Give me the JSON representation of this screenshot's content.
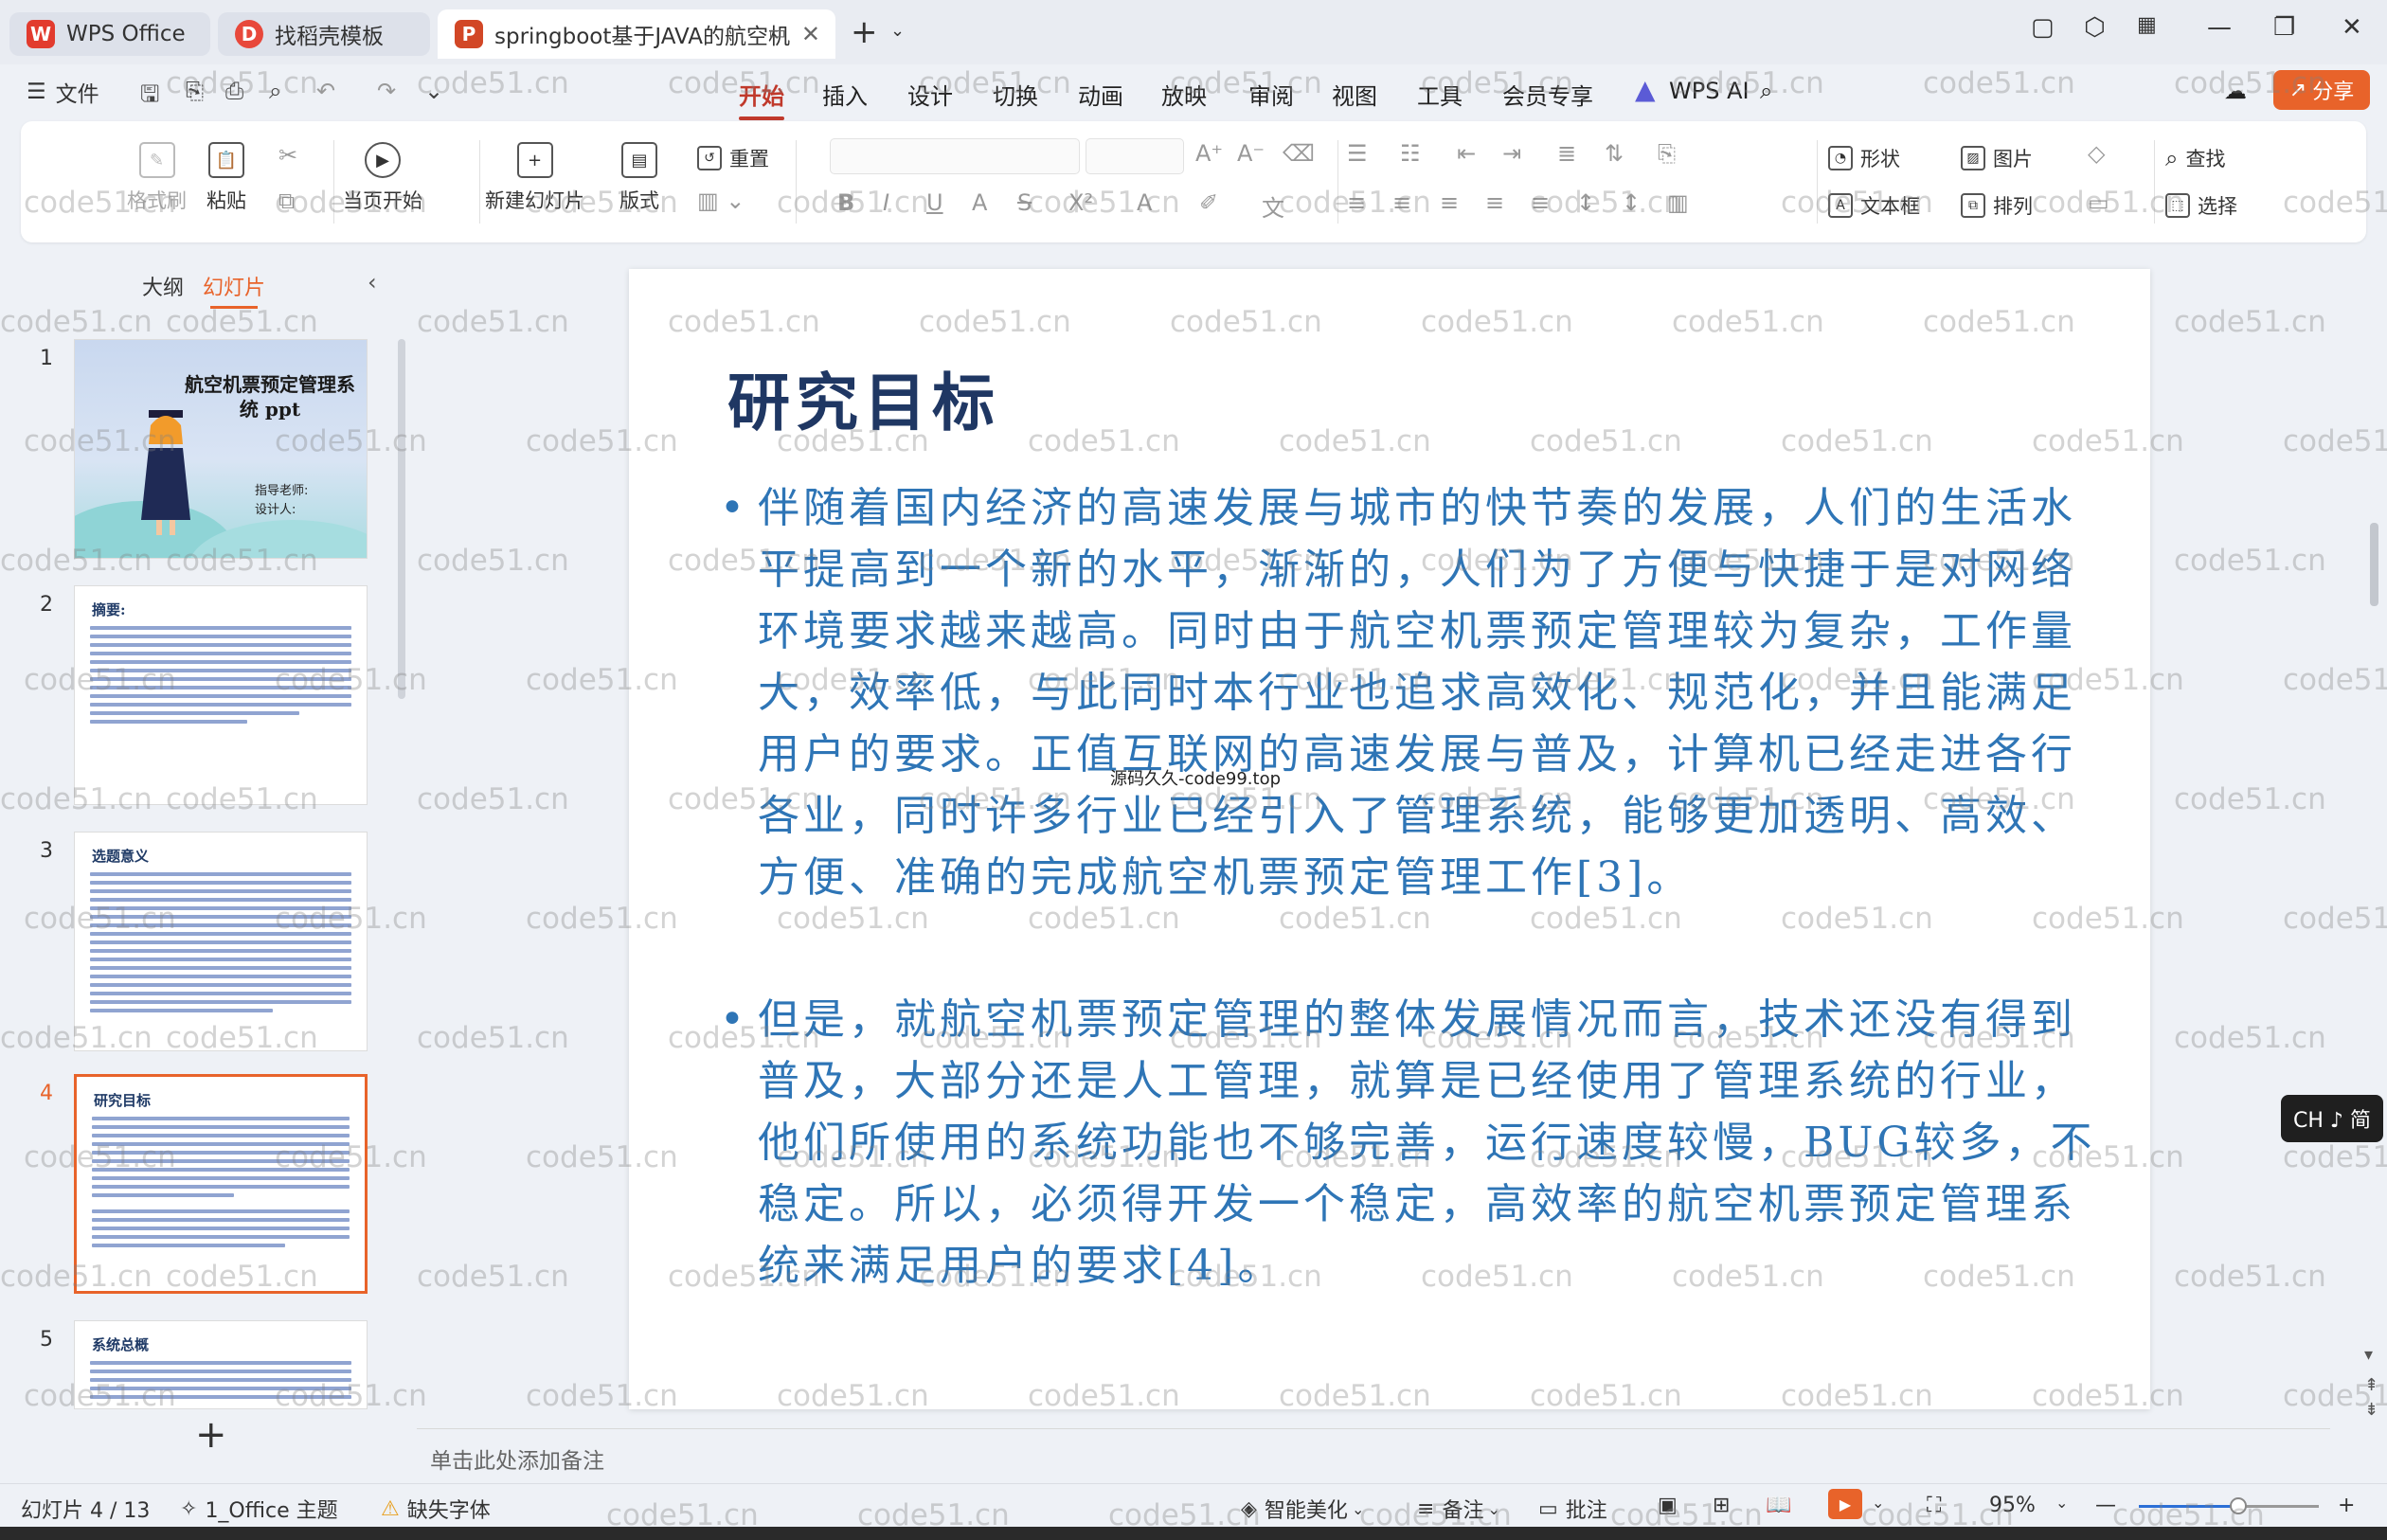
{
  "window": {
    "tabs": [
      {
        "label": "WPS Office",
        "logo": "W",
        "color": "#e23b2e"
      },
      {
        "label": "找稻壳模板",
        "logo": "D",
        "color": "#e8483b"
      },
      {
        "label": "springboot基于JAVA的航空机",
        "logo": "P",
        "color": "#d24726"
      }
    ]
  },
  "menu": {
    "file_label": "文件",
    "tabs": [
      "开始",
      "插入",
      "设计",
      "切换",
      "动画",
      "放映",
      "审阅",
      "视图",
      "工具",
      "会员专享",
      "WPS AI"
    ],
    "active_tab": "开始",
    "share_label": "分享"
  },
  "ribbon": {
    "format_painter": "格式刷",
    "paste": "粘贴",
    "play_current": "当页开始",
    "new_slide": "新建幻灯片",
    "layout": "版式",
    "reset": "重置",
    "shape": "形状",
    "picture": "图片",
    "find": "查找",
    "textbox": "文本框",
    "arrange": "排列",
    "select": "选择"
  },
  "panel": {
    "tab_outline": "大纲",
    "tab_slides": "幻灯片",
    "active_slide": 4,
    "slides": [
      {
        "num": "1",
        "title": "航空机票预定管理系统 ppt",
        "advisor": "指导老师:",
        "designer": "设计人:"
      },
      {
        "num": "2",
        "title": "摘要:"
      },
      {
        "num": "3",
        "title": "选题意义"
      },
      {
        "num": "4",
        "title": "研究目标"
      },
      {
        "num": "5",
        "title": "系统总概"
      }
    ]
  },
  "slide": {
    "title": "研究目标",
    "bullets": [
      "伴随着国内经济的高速发展与城市的快节奏的发展，人们的生活水平提高到一个新的水平，渐渐的，人们为了方便与快捷于是对网络环境要求越来越高。同时由于航空机票预定管理较为复杂，工作量大，效率低，与此同时本行业也追求高效化、规范化，并且能满足用户的要求。正值互联网的高速发展与普及，计算机已经走进各行各业，同时许多行业已经引入了管理系统，能够更加透明、高效、方便、准确的完成航空机票预定管理工作[3]。",
      "但是，就航空机票预定管理的整体发展情况而言，技术还没有得到普及，大部分还是人工管理，就算是已经使用了管理系统的行业，他们所使用的系统功能也不够完善，运行速度较慢，BUG较多，不稳定。所以，必须得开发一个稳定，高效率的航空机票预定管理系统来满足用户的要求[4]。"
    ],
    "overlay_text": "源码久久-code99.top"
  },
  "notes_placeholder": "单击此处添加备注",
  "ime": "CH ♪ 简",
  "status": {
    "slide_counter": "幻灯片 4 / 13",
    "theme": "1_Office 主题",
    "missing_font": "缺失字体",
    "beautify": "智能美化",
    "notes": "备注",
    "comments": "批注",
    "zoom": "95%",
    "zoom_level": 0.55
  },
  "watermark": "code51.cn",
  "colors": {
    "accent": "#e8632a",
    "title": "#1f3763",
    "body": "#2e75b6"
  }
}
